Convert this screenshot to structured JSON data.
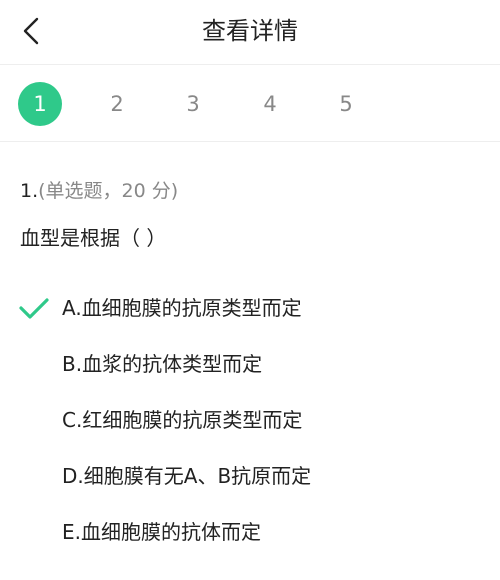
{
  "header": {
    "title": "查看详情"
  },
  "pager": {
    "pages": [
      "1",
      "2",
      "3",
      "4",
      "5"
    ],
    "active_index": 0
  },
  "question": {
    "number": "1.",
    "type_info": "(单选题，20 分)",
    "text": "血型是根据（  ）",
    "options": [
      {
        "label": "A.血细胞膜的抗原类型而定",
        "selected": true
      },
      {
        "label": "B.血浆的抗体类型而定",
        "selected": false
      },
      {
        "label": "C.红细胞膜的抗原类型而定",
        "selected": false
      },
      {
        "label": "D.细胞膜有无A、B抗原而定",
        "selected": false
      },
      {
        "label": "E.血细胞膜的抗体而定",
        "selected": false
      }
    ]
  },
  "colors": {
    "accent": "#2fc98a",
    "muted": "#888888",
    "text": "#222222"
  }
}
